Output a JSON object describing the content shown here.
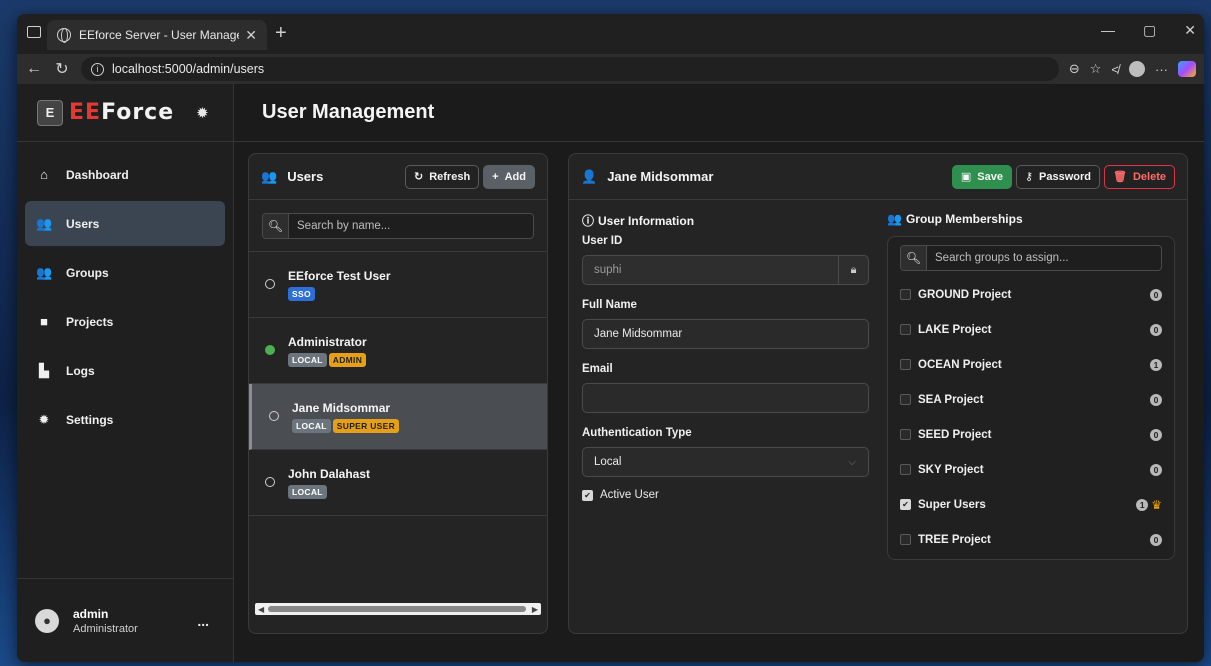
{
  "browser": {
    "tab_title": "EEforce Server - User Manageme",
    "url": "localhost:5000/admin/users"
  },
  "brand": {
    "ee": "EE",
    "rest": "Force"
  },
  "page": {
    "title": "User Management"
  },
  "sidebar": {
    "items": [
      {
        "label": "Dashboard",
        "icon": "home-icon"
      },
      {
        "label": "Users",
        "icon": "users-icon"
      },
      {
        "label": "Groups",
        "icon": "groups-icon"
      },
      {
        "label": "Projects",
        "icon": "folder-icon"
      },
      {
        "label": "Logs",
        "icon": "file-icon"
      },
      {
        "label": "Settings",
        "icon": "gear-icon"
      }
    ],
    "active": "Users",
    "footer": {
      "name": "admin",
      "role": "Administrator",
      "more": "..."
    }
  },
  "users_panel": {
    "title": "Users",
    "refresh_label": "Refresh",
    "add_label": "Add",
    "search_placeholder": "Search by name...",
    "users": [
      {
        "name": "EEforce Test User",
        "online": false,
        "badges": [
          "SSO"
        ]
      },
      {
        "name": "Administrator",
        "online": true,
        "badges": [
          "LOCAL",
          "ADMIN"
        ]
      },
      {
        "name": "Jane Midsommar",
        "online": false,
        "badges": [
          "LOCAL",
          "SUPER USER"
        ],
        "selected": true
      },
      {
        "name": "John Dalahast",
        "online": false,
        "badges": [
          "LOCAL"
        ]
      }
    ]
  },
  "detail": {
    "user_name": "Jane Midsommar",
    "save_label": "Save",
    "password_label": "Password",
    "delete_label": "Delete",
    "info_title": "User Information",
    "user_id_label": "User ID",
    "user_id_value": "suphi",
    "full_name_label": "Full Name",
    "full_name_value": "Jane Midsommar",
    "email_label": "Email",
    "email_value": "",
    "auth_label": "Authentication Type",
    "auth_value": "Local",
    "active_label": "Active User",
    "active_checked": true,
    "groups_title": "Group Memberships",
    "groups_search_placeholder": "Search groups to assign...",
    "groups": [
      {
        "name": "GROUND Project",
        "count": "0",
        "checked": false
      },
      {
        "name": "LAKE Project",
        "count": "0",
        "checked": false
      },
      {
        "name": "OCEAN Project",
        "count": "1",
        "checked": false
      },
      {
        "name": "SEA Project",
        "count": "0",
        "checked": false
      },
      {
        "name": "SEED Project",
        "count": "0",
        "checked": false
      },
      {
        "name": "SKY Project",
        "count": "0",
        "checked": false
      },
      {
        "name": "Super Users",
        "count": "1",
        "checked": true,
        "crown": true
      },
      {
        "name": "TREE Project",
        "count": "0",
        "checked": false
      }
    ]
  },
  "colors": {
    "accent_green": "#2f8f4e",
    "danger": "#dc3545",
    "sso_badge": "#2d6fd6",
    "local_badge": "#6c757d",
    "admin_badge": "#e6a017",
    "online": "#4caf50"
  }
}
